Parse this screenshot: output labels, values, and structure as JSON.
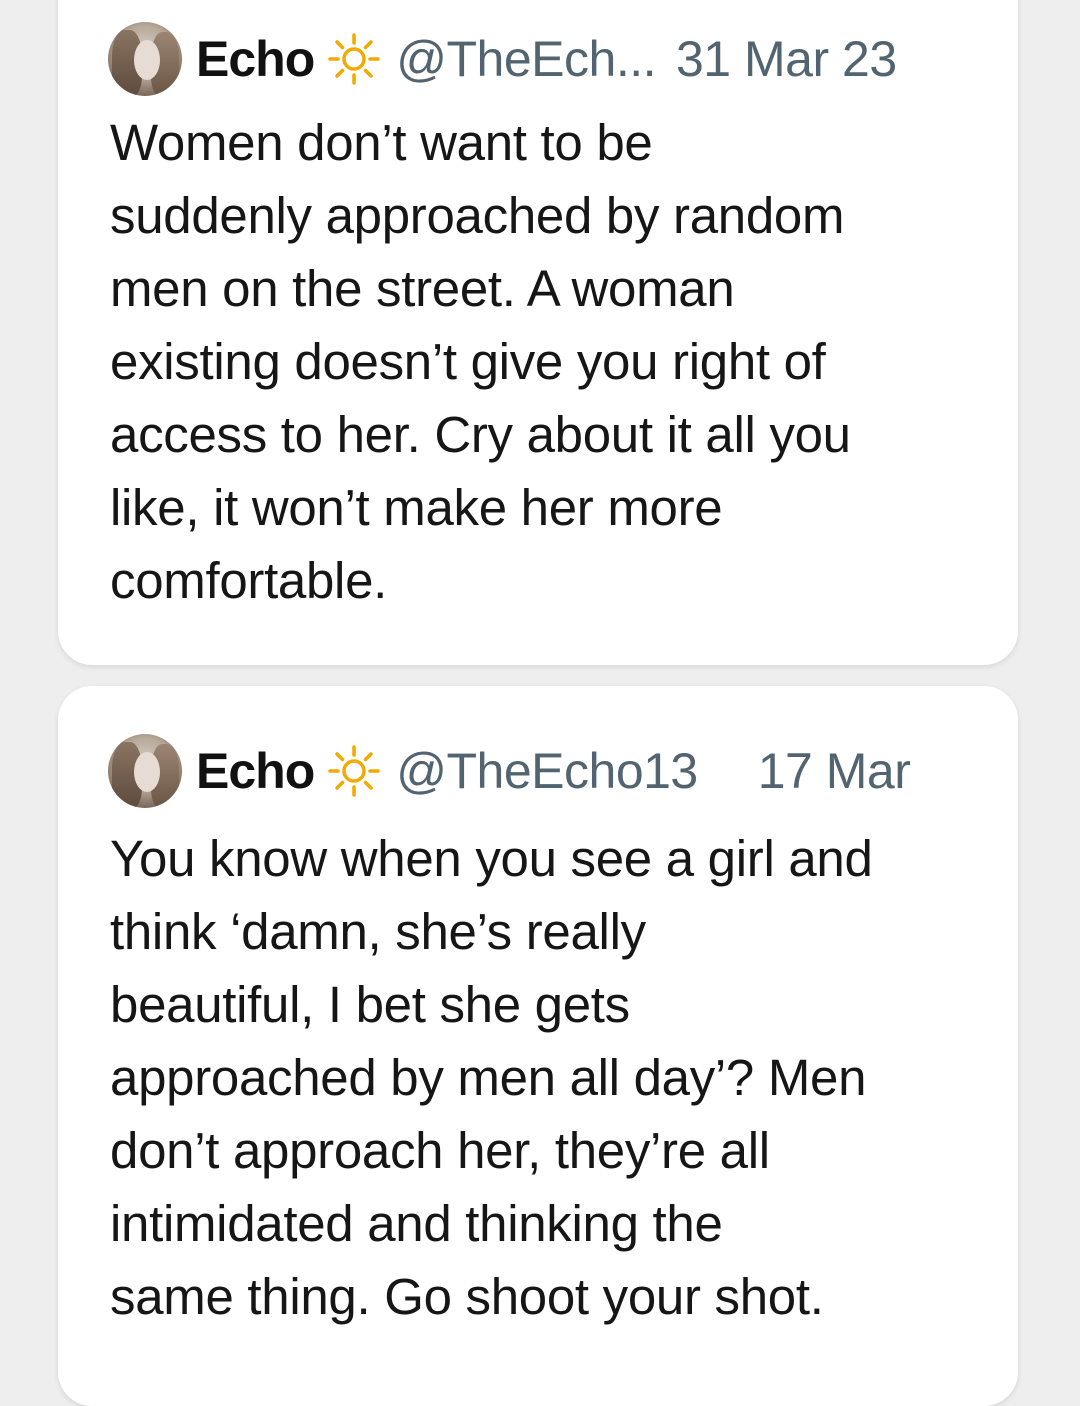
{
  "tweets": [
    {
      "author_name": "Echo",
      "author_icon": "sun-icon",
      "handle": "@TheEch...",
      "date": "31 Mar 23",
      "text": "Women don’t want to be\nsuddenly approached by random\nmen on the street. A woman\nexisting doesn’t give you right of\naccess to her. Cry about it all you\nlike, it won’t make her more\ncomfortable."
    },
    {
      "author_name": "Echo",
      "author_icon": "sun-icon",
      "handle": "@TheEcho13",
      "date": "17 Mar",
      "text": "You know when you see a girl and\nthink ‘damn, she’s really\nbeautiful, I bet she gets\napproached by men all day’? Men\ndon’t approach her, they’re all\nintimidated and thinking the\nsame thing. Go shoot your shot."
    }
  ],
  "colors": {
    "background": "#eeeeee",
    "card": "#ffffff",
    "muted_text": "#536471",
    "sun_icon": "#f2a900"
  }
}
